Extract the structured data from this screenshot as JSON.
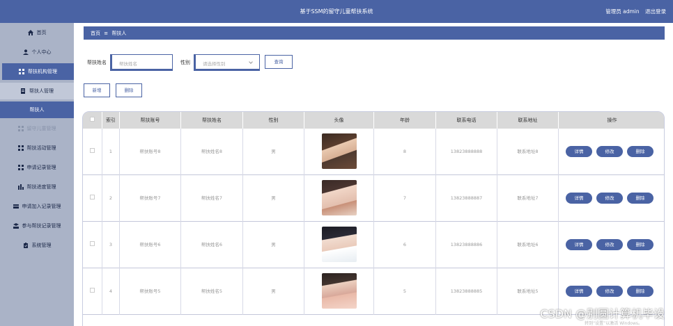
{
  "header": {
    "title": "基于SSM的留守儿童帮扶系统",
    "admin_label": "管理员 admin",
    "logout": "退出登录"
  },
  "sidebar": {
    "items": [
      {
        "label": "首页",
        "icon": "home-icon"
      },
      {
        "label": "个人中心",
        "icon": "user-icon"
      },
      {
        "label": "帮扶机构管理",
        "icon": "grid-icon"
      },
      {
        "label": "帮扶人管理",
        "icon": "doc-icon"
      },
      {
        "label": "帮扶人",
        "icon": ""
      },
      {
        "label": "留守儿童管理",
        "icon": "grid-icon"
      },
      {
        "label": "帮扶活动管理",
        "icon": "grid-icon"
      },
      {
        "label": "申请记录管理",
        "icon": "grid-icon"
      },
      {
        "label": "帮扶进度管理",
        "icon": "chart-icon"
      },
      {
        "label": "申请加入记录管理",
        "icon": "card-icon"
      },
      {
        "label": "参与帮扶记录管理",
        "icon": "stack-icon"
      },
      {
        "label": "系统管理",
        "icon": "clipboard-icon"
      }
    ]
  },
  "breadcrumb": {
    "home": "首页",
    "sep": "≡",
    "current": "帮扶人"
  },
  "search": {
    "name_label": "帮扶姓名",
    "name_placeholder": "帮扶姓名",
    "gender_label": "性别",
    "gender_placeholder": "请选择性别",
    "query_button": "查询"
  },
  "actions": {
    "add": "新增",
    "delete": "删除"
  },
  "table": {
    "columns": [
      "索引",
      "帮扶账号",
      "帮扶姓名",
      "性别",
      "头像",
      "年龄",
      "联系电话",
      "联系地址",
      "操作"
    ],
    "rows": [
      {
        "index": "1",
        "account": "帮扶账号8",
        "name": "帮扶姓名8",
        "gender": "男",
        "age": "8",
        "phone": "13823888888",
        "address": "联系地址8"
      },
      {
        "index": "2",
        "account": "帮扶账号7",
        "name": "帮扶姓名7",
        "gender": "男",
        "age": "7",
        "phone": "13823888887",
        "address": "联系地址7"
      },
      {
        "index": "3",
        "account": "帮扶账号6",
        "name": "帮扶姓名6",
        "gender": "男",
        "age": "6",
        "phone": "13823888886",
        "address": "联系地址6"
      },
      {
        "index": "4",
        "account": "帮扶账号5",
        "name": "帮扶姓名5",
        "gender": "男",
        "age": "5",
        "phone": "13823888885",
        "address": "联系地址5"
      }
    ],
    "op_buttons": {
      "detail": "详情",
      "edit": "修改",
      "delete": "删除"
    }
  },
  "watermark": "CSDN @别圆计算机毕设",
  "activation_text": "转到“设置”以激活 Windows。",
  "colors": {
    "primary": "#4a63a4",
    "sidebar": "#aab3c7"
  }
}
